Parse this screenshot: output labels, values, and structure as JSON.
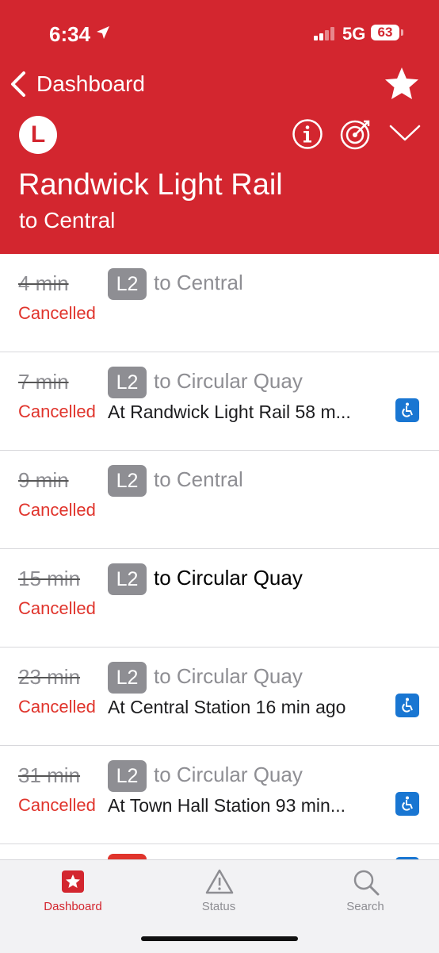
{
  "status_bar": {
    "time": "6:34",
    "network": "5G",
    "battery": "63"
  },
  "header": {
    "back_label": "Dashboard",
    "line_badge": "L",
    "title": "Randwick Light Rail",
    "subtitle": "to Central",
    "colors": {
      "brand": "#d3262f",
      "cancelled": "#e0342c",
      "accessible": "#1976d2",
      "route_badge": "#8e8e93"
    },
    "icons": [
      "chevron-left-icon",
      "star-icon",
      "info-icon",
      "tracking-icon",
      "chevron-down-icon"
    ]
  },
  "departures": [
    {
      "minutes": "4 min",
      "status": "Cancelled",
      "route": "L2",
      "destination": "to Central",
      "info": "",
      "accessible": false
    },
    {
      "minutes": "7 min",
      "status": "Cancelled",
      "route": "L2",
      "destination": "to Circular Quay",
      "info": "At Randwick Light Rail 58 m...",
      "accessible": true
    },
    {
      "minutes": "9 min",
      "status": "Cancelled",
      "route": "L2",
      "destination": "to Central",
      "info": "",
      "accessible": false
    },
    {
      "minutes": "15 min",
      "status": "Cancelled",
      "route": "L2",
      "destination_prefix": "to",
      "destination": "Circular Quay",
      "info": "",
      "accessible": false
    },
    {
      "minutes": "23 min",
      "status": "Cancelled",
      "route": "L2",
      "destination": "to Circular Quay",
      "info": "At Central Station 16 min ago",
      "accessible": true
    },
    {
      "minutes": "31 min",
      "status": "Cancelled",
      "route": "L2",
      "destination": "to Circular Quay",
      "info": "At Town Hall Station 93 min...",
      "accessible": true
    }
  ],
  "tabs": [
    {
      "label": "Dashboard",
      "icon": "star-square-icon",
      "active": true
    },
    {
      "label": "Status",
      "icon": "warning-icon",
      "active": false
    },
    {
      "label": "Search",
      "icon": "search-icon",
      "active": false
    }
  ]
}
